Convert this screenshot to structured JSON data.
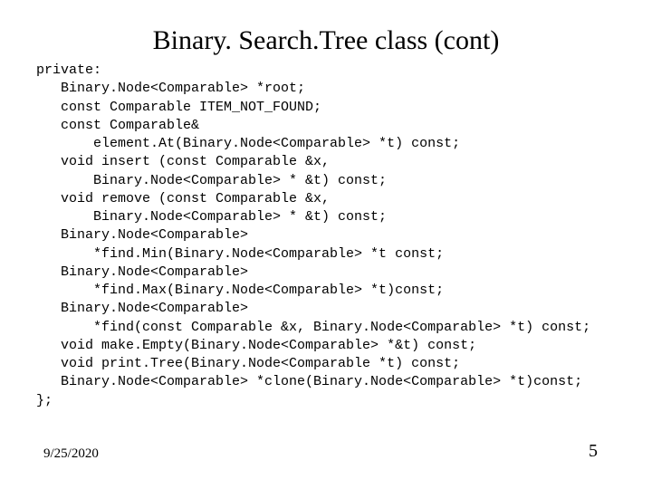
{
  "slide": {
    "title": "Binary. Search.Tree class (cont)",
    "code_lines": [
      "private:",
      "   Binary.Node<Comparable> *root;",
      "   const Comparable ITEM_NOT_FOUND;",
      "   const Comparable&",
      "       element.At(Binary.Node<Comparable> *t) const;",
      "   void insert (const Comparable &x,",
      "       Binary.Node<Comparable> * &t) const;",
      "   void remove (const Comparable &x,",
      "       Binary.Node<Comparable> * &t) const;",
      "   Binary.Node<Comparable>",
      "       *find.Min(Binary.Node<Comparable> *t const;",
      "   Binary.Node<Comparable>",
      "       *find.Max(Binary.Node<Comparable> *t)const;",
      "   Binary.Node<Comparable>",
      "       *find(const Comparable &x, Binary.Node<Comparable> *t) const;",
      "   void make.Empty(Binary.Node<Comparable> *&t) const;",
      "   void print.Tree(Binary.Node<Comparable *t) const;",
      "   Binary.Node<Comparable> *clone(Binary.Node<Comparable> *t)const;",
      "};"
    ],
    "footer_date": "9/25/2020",
    "footer_page": "5"
  }
}
